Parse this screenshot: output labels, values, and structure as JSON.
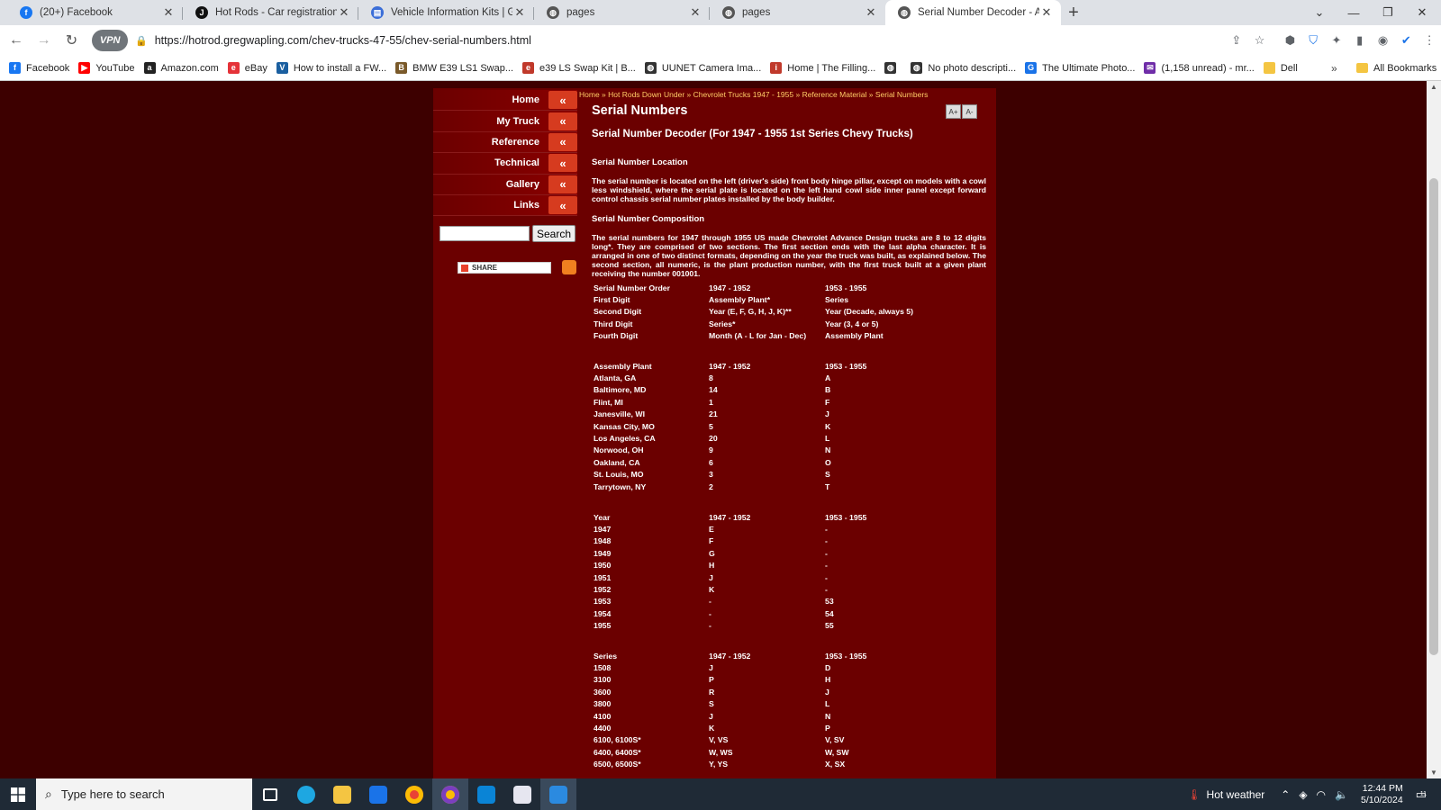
{
  "browser": {
    "tabs": [
      {
        "title": "(20+) Facebook",
        "icon": "facebook-icon",
        "color": "#1877f2",
        "glyph": "f"
      },
      {
        "title": "Hot Rods - Car registration in Ca",
        "icon": "j-icon",
        "color": "#111111",
        "glyph": "J"
      },
      {
        "title": "Vehicle Information Kits | GM He",
        "icon": "gm-icon",
        "color": "#3b6ed8",
        "glyph": "▤"
      },
      {
        "title": "pages",
        "icon": "globe-icon",
        "color": "#555555",
        "glyph": "◍"
      },
      {
        "title": "pages",
        "icon": "globe-icon",
        "color": "#555555",
        "glyph": "◍"
      },
      {
        "title": "Serial Number Decoder - Advan",
        "icon": "globe-icon",
        "color": "#555555",
        "glyph": "◍"
      }
    ],
    "url": "https://hotrod.gregwapling.com/chev-trucks-47-55/chev-serial-numbers.html",
    "vpn_label": "VPN",
    "bookmarks": [
      {
        "label": "Facebook",
        "color": "#1877f2",
        "glyph": "f"
      },
      {
        "label": "YouTube",
        "color": "#ff0000",
        "glyph": "▶"
      },
      {
        "label": "Amazon.com",
        "color": "#222222",
        "glyph": "a"
      },
      {
        "label": "eBay",
        "color": "#e53238",
        "glyph": "e"
      },
      {
        "label": "How to install a FW...",
        "color": "#1a5fa0",
        "glyph": "V"
      },
      {
        "label": "BMW E39 LS1 Swap...",
        "color": "#7a5a2a",
        "glyph": "B"
      },
      {
        "label": "e39 LS Swap Kit | B...",
        "color": "#c0392b",
        "glyph": "e"
      },
      {
        "label": "UUNET Camera Ima...",
        "color": "#333333",
        "glyph": "◍"
      },
      {
        "label": "Home | The Filling...",
        "color": "#c0392b",
        "glyph": "i"
      },
      {
        "label": "",
        "color": "#333333",
        "glyph": "◍"
      },
      {
        "label": "No photo descripti...",
        "color": "#333333",
        "glyph": "◍"
      },
      {
        "label": "The Ultimate Photo...",
        "color": "#1a73e8",
        "glyph": "G"
      },
      {
        "label": "(1,158 unread) - mr...",
        "color": "#6f2da8",
        "glyph": "✉"
      },
      {
        "label": "Dell",
        "color": "#f4c542",
        "glyph": ""
      }
    ],
    "all_bookmarks": "All Bookmarks"
  },
  "site": {
    "nav": [
      {
        "label": "Home"
      },
      {
        "label": "My Truck"
      },
      {
        "label": "Reference"
      },
      {
        "label": "Technical"
      },
      {
        "label": "Gallery"
      },
      {
        "label": "Links"
      }
    ],
    "nav_chevron": "«",
    "search_button": "Search",
    "share_label": "SHARE",
    "breadcrumb": "Home » Hot Rods Down Under » Chevrolet Trucks 1947 - 1955 » Reference Material » Serial Numbers",
    "page_title": "Serial Numbers",
    "font_buttons": [
      "A+",
      "A-"
    ],
    "subtitle": "Serial Number Decoder (For 1947 - 1955 1st Series Chevy Trucks)",
    "section_location": "Serial Number Location",
    "para_location": "The serial number is located on the left (driver's side) front body hinge pillar, except on models with a cowl less windshield, where the serial plate is located on the left hand cowl side inner panel except forward control chassis serial number plates installed by the body builder.",
    "section_composition": "Serial Number Composition",
    "para_composition": "The serial numbers for 1947 through 1955 US made Chevrolet Advance Design trucks are 8 to 12 digits long*. They are comprised of two sections. The first section ends with the last alpha character. It is arranged in one of two distinct formats, depending on the year the truck was built, as explained below. The second section, all numeric, is the plant production number, with the first truck built at a given plant receiving the number 001001.",
    "tables": [
      {
        "rows": [
          [
            "Serial Number Order",
            "1947 - 1952",
            "1953 - 1955"
          ],
          [
            "First Digit",
            "Assembly Plant*",
            "Series"
          ],
          [
            "Second Digit",
            "Year (E, F, G, H, J, K)**",
            "Year (Decade, always 5)"
          ],
          [
            "Third Digit",
            "Series*",
            "Year (3, 4 or 5)"
          ],
          [
            "Fourth Digit",
            "Month (A - L for Jan - Dec)",
            "Assembly Plant"
          ]
        ]
      },
      {
        "rows": [
          [
            "Assembly Plant",
            "1947 - 1952",
            "1953 - 1955"
          ],
          [
            "Atlanta, GA",
            "8",
            "A"
          ],
          [
            "Baltimore, MD",
            "14",
            "B"
          ],
          [
            "Flint, MI",
            "1",
            "F"
          ],
          [
            "Janesville, WI",
            "21",
            "J"
          ],
          [
            "Kansas City, MO",
            "5",
            "K"
          ],
          [
            "Los Angeles, CA",
            "20",
            "L"
          ],
          [
            "Norwood, OH",
            "9",
            "N"
          ],
          [
            "Oakland, CA",
            "6",
            "O"
          ],
          [
            "St. Louis, MO",
            "3",
            "S"
          ],
          [
            "Tarrytown, NY",
            "2",
            "T"
          ]
        ]
      },
      {
        "rows": [
          [
            "Year",
            "1947 - 1952",
            "1953 - 1955"
          ],
          [
            "1947",
            "E",
            "-"
          ],
          [
            "1948",
            "F",
            "-"
          ],
          [
            "1949",
            "G",
            "-"
          ],
          [
            "1950",
            "H",
            "-"
          ],
          [
            "1951",
            "J",
            "-"
          ],
          [
            "1952",
            "K",
            "-"
          ],
          [
            "1953",
            "-",
            "53"
          ],
          [
            "1954",
            "-",
            "54"
          ],
          [
            "1955",
            "-",
            "55"
          ]
        ]
      },
      {
        "rows": [
          [
            "Series",
            "1947 - 1952",
            "1953 - 1955"
          ],
          [
            "1508",
            "J",
            "D"
          ],
          [
            "3100",
            "P",
            "H"
          ],
          [
            "3600",
            "R",
            "J"
          ],
          [
            "3800",
            "S",
            "L"
          ],
          [
            "4100",
            "J",
            "N"
          ],
          [
            "4400",
            "K",
            "P"
          ],
          [
            "6100, 6100S*",
            "V, VS",
            "V, SV"
          ],
          [
            "6400, 6400S*",
            "W, WS",
            "W, SW"
          ],
          [
            "6500, 6500S*",
            "Y, YS",
            "X, SX"
          ]
        ]
      }
    ]
  },
  "taskbar": {
    "search_placeholder": "Type here to search",
    "weather": "Hot weather",
    "time": "12:44 PM",
    "date": "5/10/2024",
    "notification_count": "11"
  }
}
